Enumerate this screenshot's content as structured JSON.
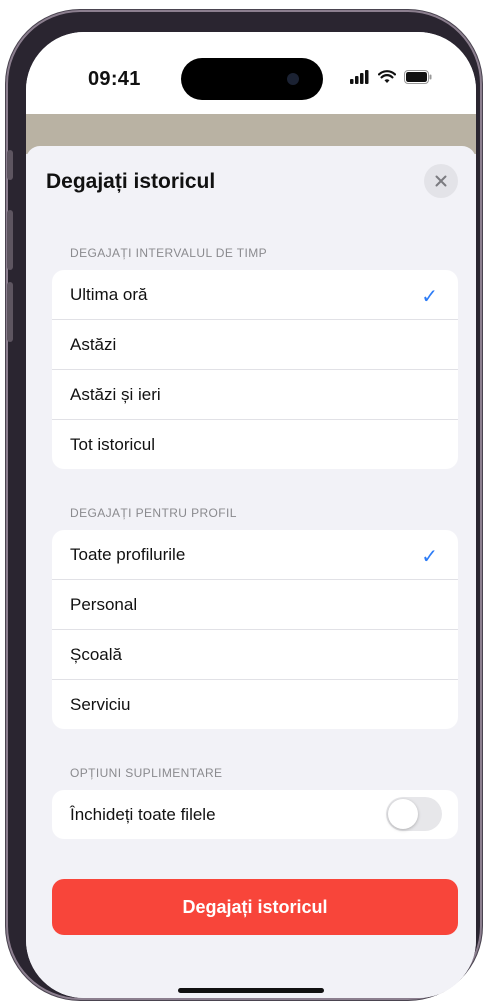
{
  "status_bar": {
    "time": "09:41"
  },
  "sheet": {
    "title": "Degajați istoricul",
    "sections": [
      {
        "header": "DEGAJAȚI INTERVALUL DE TIMP",
        "items": [
          {
            "label": "Ultima oră",
            "checked": true
          },
          {
            "label": "Astăzi",
            "checked": false
          },
          {
            "label": "Astăzi și ieri",
            "checked": false
          },
          {
            "label": "Tot istoricul",
            "checked": false
          }
        ]
      },
      {
        "header": "DEGAJAȚI PENTRU PROFIL",
        "items": [
          {
            "label": "Toate profilurile",
            "checked": true
          },
          {
            "label": "Personal",
            "checked": false
          },
          {
            "label": "Școală",
            "checked": false
          },
          {
            "label": "Serviciu",
            "checked": false
          }
        ]
      },
      {
        "header": "OPȚIUNI SUPLIMENTARE",
        "items": [
          {
            "label": "Închideți toate filele",
            "toggle": false
          }
        ]
      }
    ],
    "action_label": "Degajați istoricul"
  },
  "colors": {
    "accent": "#2d7cf6",
    "destructive": "#f8453a",
    "sheet_bg": "#f2f2f7"
  },
  "icons": {
    "checkmark": "checkmark-icon",
    "close": "close-icon"
  }
}
